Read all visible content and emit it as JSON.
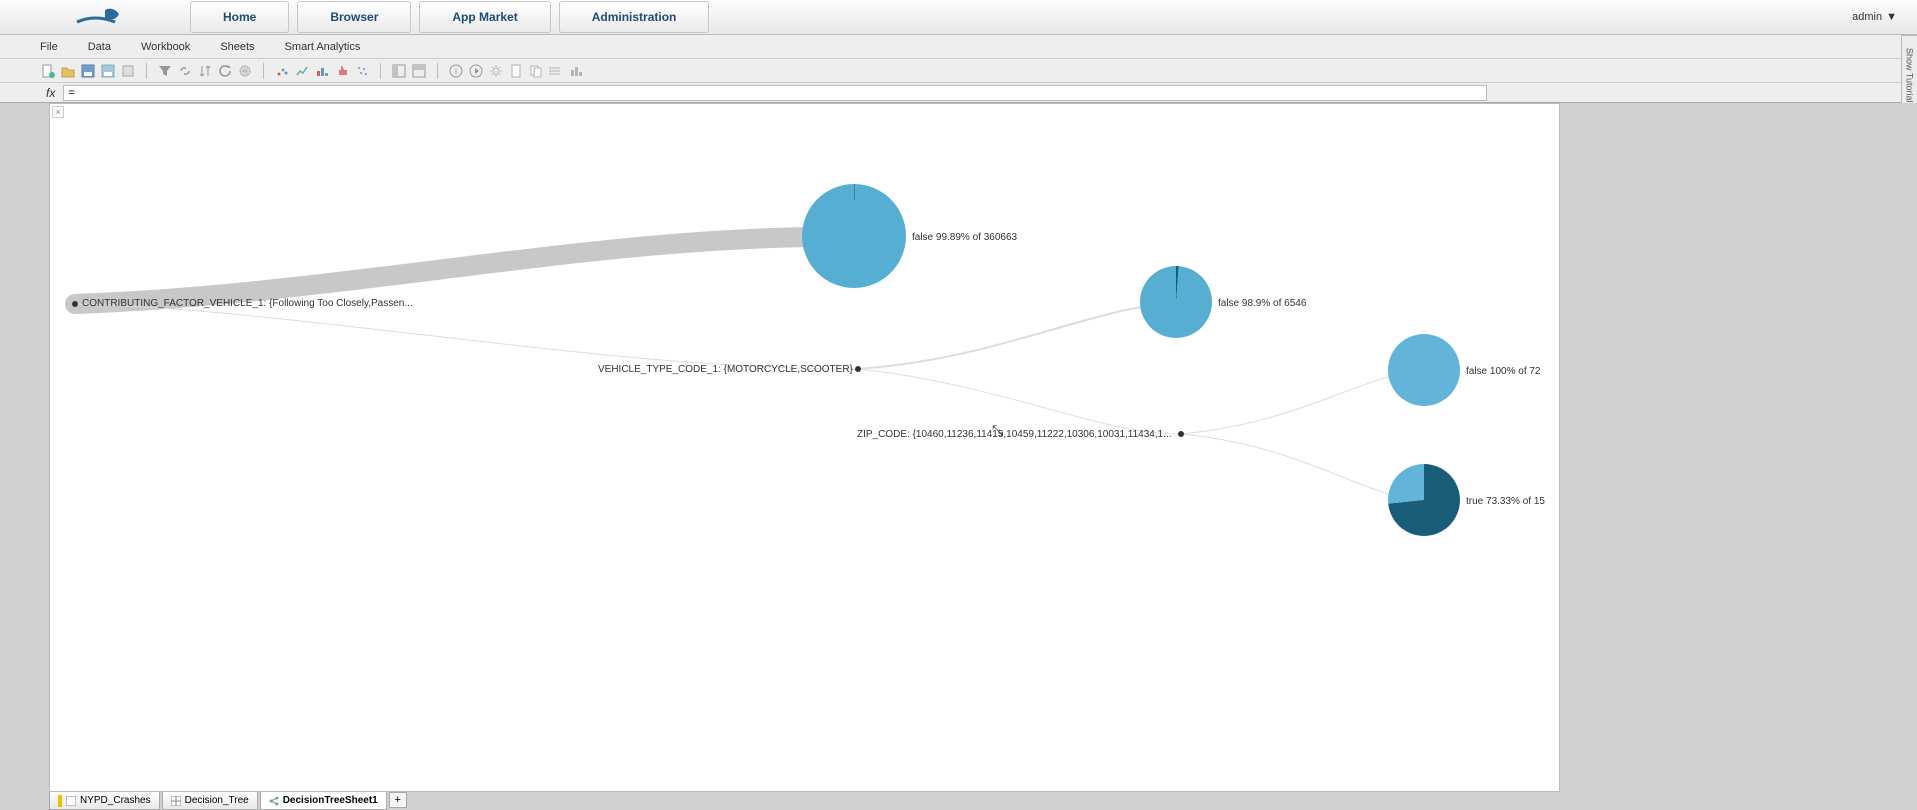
{
  "header": {
    "nav": [
      "Home",
      "Browser",
      "App Market",
      "Administration"
    ],
    "user": "admin"
  },
  "tutorial_tab": "Show Tutorial",
  "menubar": [
    "File",
    "Data",
    "Workbook",
    "Sheets",
    "Smart Analytics"
  ],
  "formula": {
    "label": "fx",
    "value": "="
  },
  "sheet_tabs": {
    "tabs": [
      "NYPD_Crashes",
      "Decision_Tree",
      "DecisionTreeSheet1"
    ],
    "active_index": 2,
    "add": "+"
  },
  "toolbar_groups": [
    [
      "new-doc",
      "open-doc",
      "save",
      "save-as",
      "export"
    ],
    [
      "filter",
      "link",
      "sort",
      "refresh",
      "globe"
    ],
    [
      "scatter",
      "line-chart",
      "bar-chart",
      "heat",
      "dots"
    ],
    [
      "layout-a",
      "layout-b"
    ],
    [
      "info",
      "play",
      "settings",
      "page",
      "copy",
      "list",
      "code"
    ]
  ],
  "chart_data": {
    "type": "decision-tree",
    "color_scale": {
      "false": "#56aed3",
      "true": "#1a5d78"
    },
    "splits": [
      {
        "id": "s0",
        "label": "CONTRIBUTING_FACTOR_VEHICLE_1: {Following Too Closely,Passen..."
      },
      {
        "id": "s1",
        "label": "VEHICLE_TYPE_CODE_1: {MOTORCYCLE,SCOOTER}"
      },
      {
        "id": "s2",
        "label": "ZIP_CODE: {10460,11236,11415,10459,11222,10306,10031,11434,1..."
      }
    ],
    "leaves": [
      {
        "id": "L1",
        "from": "s0",
        "class": "false",
        "pct": 99.89,
        "n": 360663,
        "dist": {
          "false": 99.89,
          "true": 0.11
        },
        "label": "false 99.89% of 360663"
      },
      {
        "id": "L2",
        "from": "s1",
        "class": "false",
        "pct": 98.9,
        "n": 6546,
        "dist": {
          "false": 98.9,
          "true": 1.1
        },
        "label": "false 98.9% of 6546"
      },
      {
        "id": "L3",
        "from": "s2",
        "class": "false",
        "pct": 100.0,
        "n": 72,
        "dist": {
          "false": 100.0,
          "true": 0.0
        },
        "label": "false 100% of 72"
      },
      {
        "id": "L4",
        "from": "s2",
        "class": "true",
        "pct": 73.33,
        "n": 15,
        "dist": {
          "true": 73.33,
          "false": 26.67
        },
        "label": "true 73.33% of 15"
      }
    ]
  }
}
